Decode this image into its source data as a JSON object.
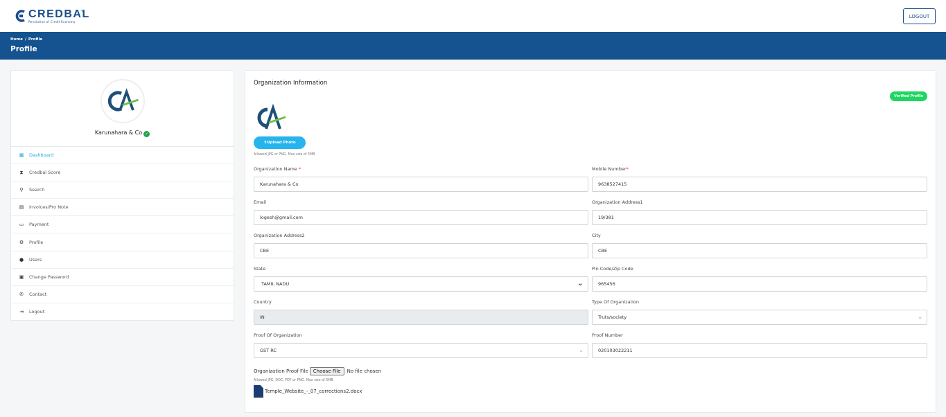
{
  "brand": {
    "name": "CREDBAL",
    "tagline": "Revolution of Credit Economy",
    "color": "#1a4d8a"
  },
  "header": {
    "logout_label": "LOGOUT"
  },
  "banner": {
    "crumbs": [
      "Home",
      "/",
      "Profile"
    ],
    "title": "Profile",
    "color": "#14538f"
  },
  "sidebar": {
    "org_name": "Karunahara & Co",
    "items": [
      {
        "label": "Dashboard",
        "icon": "dashboard-icon",
        "active": true
      },
      {
        "label": "Credbal Score",
        "icon": "hourglass-icon"
      },
      {
        "label": "Search",
        "icon": "search-icon"
      },
      {
        "label": "Invoices/Pro Note",
        "icon": "document-icon"
      },
      {
        "label": "Payment",
        "icon": "credit-card-icon"
      },
      {
        "label": "Profile",
        "icon": "user-settings-icon"
      },
      {
        "label": "Users",
        "icon": "user-icon"
      },
      {
        "label": "Change Password",
        "icon": "lock-icon"
      },
      {
        "label": "Contact",
        "icon": "phone-icon"
      },
      {
        "label": "Logout",
        "icon": "sign-out-icon"
      }
    ]
  },
  "main": {
    "title": "Organization Information",
    "verified_label": "Verified Profile",
    "upload_label": "Upload Photo",
    "photo_hint": "Allowed JPG or PNG. Max size of 5MB",
    "fields": {
      "org_name": {
        "label": "Organization Name",
        "value": "Karunahara & Co"
      },
      "mobile": {
        "label": "Mobile Number",
        "value": "9638527415"
      },
      "email": {
        "label": "Email",
        "value": "logesh@gmail.com"
      },
      "address1": {
        "label": "Organization Address1",
        "value": "19/381"
      },
      "address2": {
        "label": "Organization Address2",
        "value": "CBE"
      },
      "city": {
        "label": "City",
        "value": "CBE"
      },
      "state": {
        "label": "State",
        "value": "TAMIL NADU"
      },
      "pin": {
        "label": "Pin Code/Zip Code",
        "value": "965456"
      },
      "country": {
        "label": "Country",
        "value": "IN"
      },
      "org_type": {
        "label": "Type Of Organization",
        "value": "Truts/society"
      },
      "proof": {
        "label": "Proof Of Organization",
        "value": "GST RC"
      },
      "proof_number": {
        "label": "Proof Number",
        "value": "020103022211"
      }
    },
    "proof_file": {
      "label": "Organization Proof File",
      "button": "Choose File",
      "status": "No file chosen",
      "hint": "Allowed JPG, DOC, PDF or PNG. Max size of 5MB",
      "existing_file": "Temple_Website_-_07_corrections2.docx"
    }
  },
  "colors": {
    "accent": "#25b4ec",
    "verified": "#1ed760",
    "active_nav": "#20a8e0"
  }
}
